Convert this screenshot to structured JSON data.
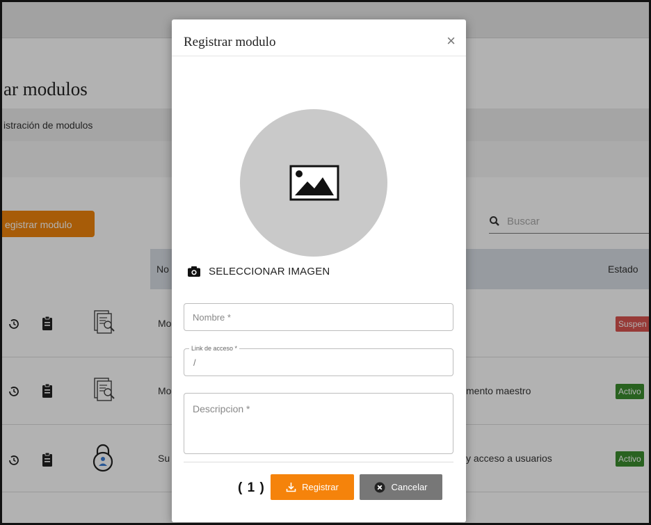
{
  "background": {
    "page_title": "ar modulos",
    "breadcrumb": "istración de modulos",
    "register_button": "egistrar modulo",
    "search_placeholder": "Buscar",
    "table": {
      "headers": [
        "No",
        "Estado"
      ],
      "rows": [
        {
          "name": "Mo",
          "description": "",
          "status": "Suspen",
          "status_color": "#d9534f",
          "row_icon": "document-search-icon"
        },
        {
          "name": "Mo",
          "description": "mento maestro",
          "status": "Activo",
          "status_color": "#3c8d2f",
          "row_icon": "document-search-icon"
        },
        {
          "name": "Su",
          "description": "y acceso a usuarios",
          "status": "Activo",
          "status_color": "#3c8d2f",
          "row_icon": "user-lock-icon"
        }
      ]
    }
  },
  "modal": {
    "title": "Registrar modulo",
    "close": "×",
    "select_image_label": "SELECCIONAR IMAGEN",
    "fields": {
      "nombre_placeholder": "Nombre *",
      "link_label": "Link de acceso *",
      "link_value": "/",
      "descripcion_placeholder": "Descripcion *"
    },
    "step_label": "( 1 )",
    "register_button": "Registrar",
    "cancel_button": "Cancelar"
  },
  "colors": {
    "accent_orange": "#f5830b",
    "cancel_gray": "#777777",
    "active_green": "#3c8d2f",
    "suspended_red": "#d9534f"
  }
}
